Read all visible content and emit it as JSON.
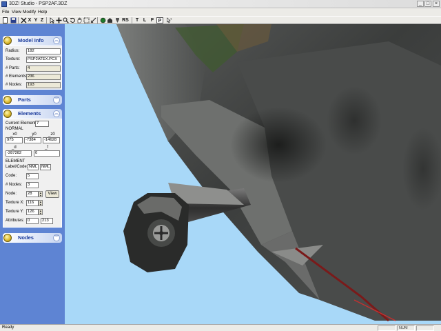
{
  "window": {
    "title": "3DZ! Studio - PSP2AF.3DZ"
  },
  "menu": [
    "File",
    "View",
    "Modify",
    "Help"
  ],
  "toolbar": {
    "axis_x": "X",
    "axis_y": "Y",
    "axis_z": "Z",
    "view_rs": "RS",
    "view_t": "T",
    "view_l": "L",
    "view_f": "F",
    "view_p": "P"
  },
  "model_info": {
    "title": "Model Info",
    "radius_label": "Radius:",
    "radius_value": "182",
    "texture_label": "Texture:",
    "texture_value": "PSP2ATEX.PCX",
    "parts_label": "# Parts:",
    "parts_value": "4",
    "elements_label": "# Elements:",
    "elements_value": "236",
    "nodes_label": "# Nodes:",
    "nodes_value": "193"
  },
  "parts": {
    "title": "Parts"
  },
  "elements": {
    "title": "Elements",
    "current_label": "Current Element:",
    "current_value": "7",
    "normal_label": "NORMAL",
    "ax_label": "_x0",
    "ay_label": "_y0",
    "az_label": "_z0",
    "ax_value": "975",
    "ay_value": "-7384",
    "az_value": "-14628",
    "bd_label": "_d",
    "bf_label": "_f",
    "bd_value": "-287282",
    "bf_value": "0",
    "element_label": "ELEMENT",
    "labelcode_label": "Label/Code:",
    "labelcode_value1": "NML",
    "labelcode_value2": "NML",
    "code_label": "Code:",
    "code_value": "5",
    "numnodes_label": "# Nodes:",
    "numnodes_value": "3",
    "node_label": "Node:",
    "node_value": "28",
    "view_button": "View",
    "texx_label": "Texture X:",
    "texx_value": "116",
    "texy_label": "Texture Y:",
    "texy_value": "126",
    "attr_label": "Attributes:",
    "attr_value1": "0",
    "attr_value2": "213"
  },
  "nodes": {
    "title": "Nodes"
  },
  "status": {
    "text": "Ready",
    "num": "NUM"
  },
  "icons": [
    "new-icon",
    "open-icon",
    "save-icon",
    "cut-axis-icon",
    "pointer-icon",
    "move-icon",
    "zoom-icon",
    "rotate-icon",
    "pan-icon",
    "select-icon",
    "color-icon",
    "texture-icon",
    "light-icon",
    "help-icon"
  ],
  "colors": {
    "panel_blue": "#5e84d3",
    "sky": "#a8d8f8",
    "section_title": "#17389a"
  }
}
